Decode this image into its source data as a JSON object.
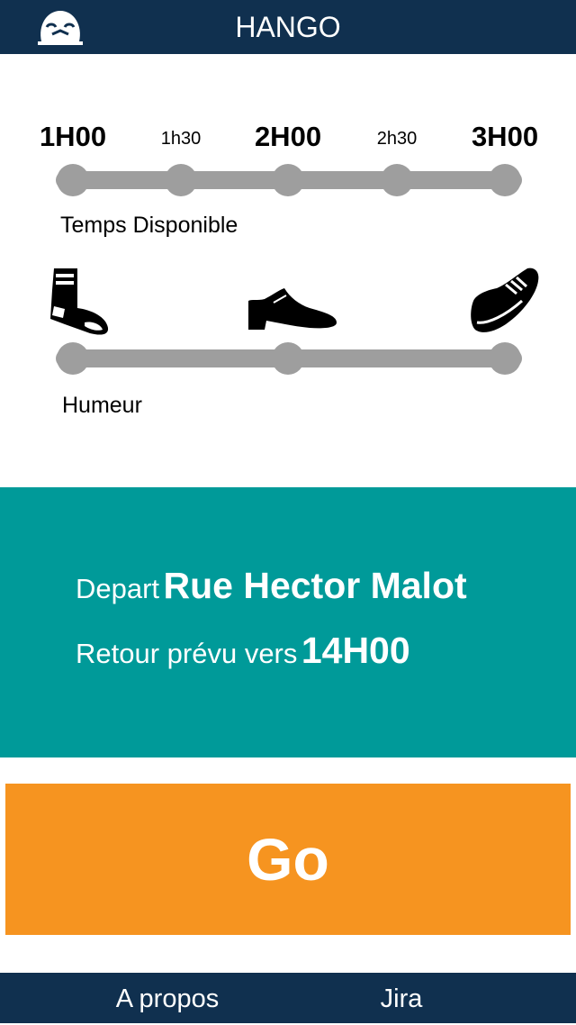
{
  "header": {
    "title": "HANGO",
    "logo_icon": "cap-logo-icon"
  },
  "time_slider": {
    "ticks": [
      "1H00",
      "1h30",
      "2H00",
      "2h30",
      "3H00"
    ],
    "label": "Temps Disponible"
  },
  "mood_slider": {
    "icons": [
      "sock-icon",
      "dress-shoe-icon",
      "sneaker-icon"
    ],
    "label": "Humeur"
  },
  "info": {
    "depart_prefix": "Depart",
    "depart_value": "Rue Hector Malot",
    "return_prefix": "Retour prévu vers",
    "return_value": "14H00"
  },
  "go_button": {
    "label": "Go"
  },
  "footer": {
    "links": [
      "A propos",
      "Jira"
    ]
  },
  "colors": {
    "header_bg": "#10304f",
    "info_bg": "#009a99",
    "go_bg": "#f69420",
    "slider": "#9e9e9e"
  }
}
